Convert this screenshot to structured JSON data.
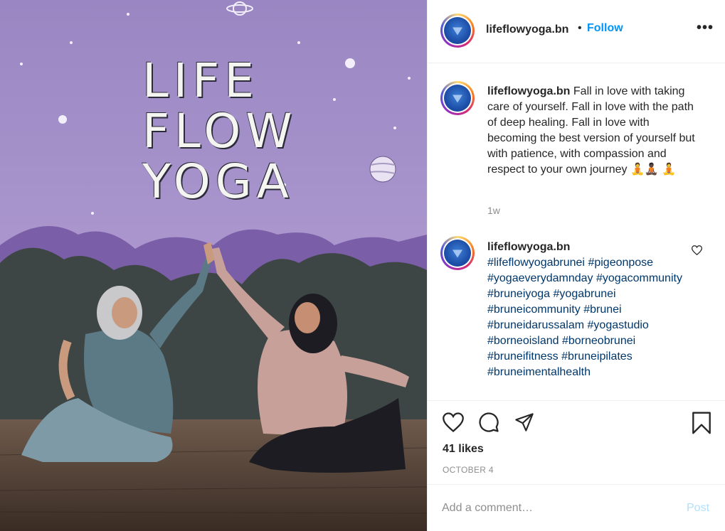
{
  "post": {
    "account": "lifeflowyoga.bn",
    "follow_label": "Follow",
    "separator": "•",
    "more_label": "•••"
  },
  "photo": {
    "wall_text": [
      "LIFE",
      "FLOW",
      "YOGA"
    ]
  },
  "caption": {
    "username": "lifeflowyoga.bn",
    "text": "Fall in love with taking care of yourself. Fall in love with the path of deep healing. Fall in love with becoming the best version of yourself but with patience, with compassion and respect to your own journey 🧘🧘🏿 🧘",
    "age": "1w"
  },
  "hashtag_comment": {
    "username": "lifeflowyoga.bn",
    "tags": [
      "#lifeflowyogabrunei",
      "#pigeonpose",
      "#yogaeverydamnday",
      "#yogacommunity",
      "#bruneiyoga",
      "#yogabrunei",
      "#bruneicommunity",
      "#brunei",
      "#bruneidarussalam",
      "#yogastudio",
      "#borneoisland",
      "#borneobrunei",
      "#bruneifitness",
      "#bruneipilates",
      "#bruneimentalhealth"
    ]
  },
  "actions": {
    "likes": "41 likes",
    "date": "OCTOBER 4"
  },
  "add_comment": {
    "placeholder": "Add a comment…",
    "post_label": "Post"
  },
  "colors": {
    "link_blue": "#0095f6",
    "hashtag": "#00376b",
    "muted": "#8e8e8e"
  }
}
